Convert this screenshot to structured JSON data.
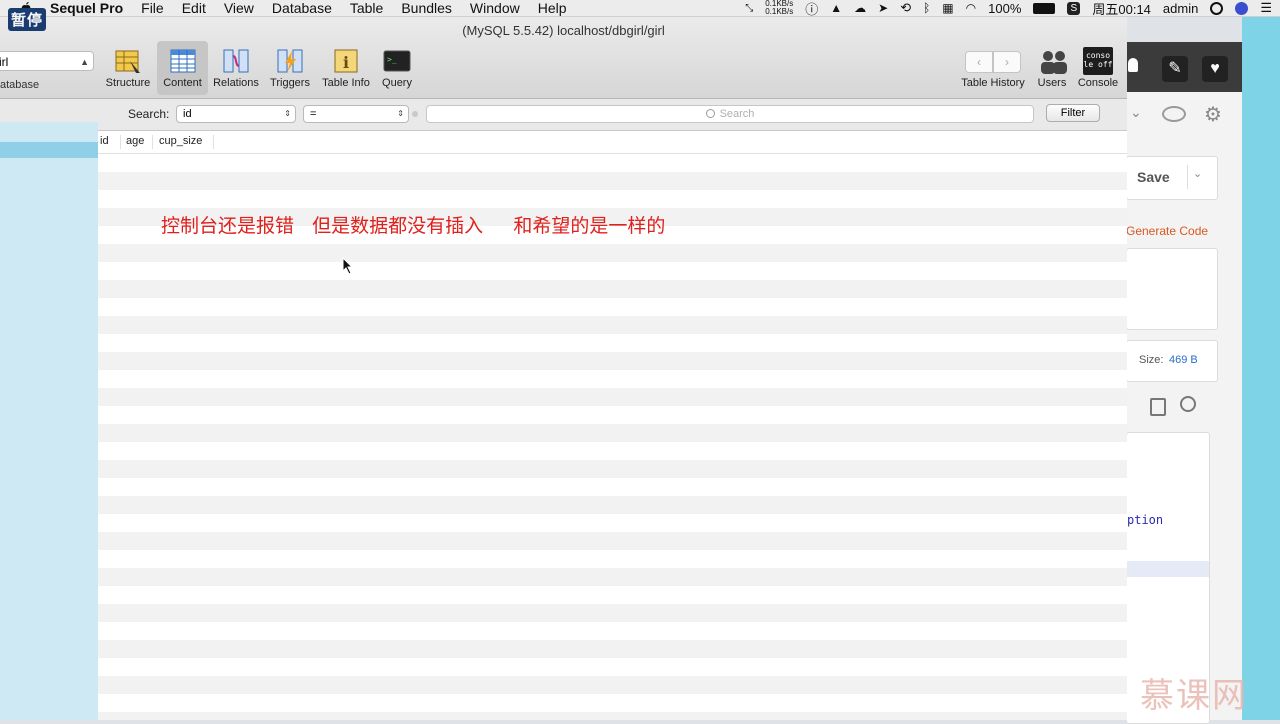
{
  "menubar": {
    "pause_label": "暂停",
    "app_name": "Sequel Pro",
    "items": [
      "File",
      "Edit",
      "View",
      "Database",
      "Table",
      "Bundles",
      "Window",
      "Help"
    ],
    "net_up": "0.1KB/s",
    "net_down": "0.1KB/s",
    "battery": "100%",
    "clock": "周五00:14",
    "user": "admin"
  },
  "window": {
    "title": "(MySQL 5.5.42) localhost/dbgirl/girl"
  },
  "toolbar": {
    "database_value": "irl",
    "database_label": "atabase",
    "buttons": [
      {
        "label": "Structure",
        "icon": "structure-icon"
      },
      {
        "label": "Content",
        "icon": "content-icon",
        "active": true
      },
      {
        "label": "Relations",
        "icon": "relations-icon"
      },
      {
        "label": "Triggers",
        "icon": "triggers-icon"
      },
      {
        "label": "Table Info",
        "icon": "table-info-icon"
      },
      {
        "label": "Query",
        "icon": "query-icon"
      }
    ],
    "table_history": "Table History",
    "users": "Users",
    "console": "Console",
    "console_icon_text": "conso le off"
  },
  "filter": {
    "search_label": "Search:",
    "field_value": "id",
    "operator_value": "=",
    "search_placeholder": "Search",
    "filter_button": "Filter"
  },
  "table": {
    "columns": [
      "id",
      "age",
      "cup_size"
    ]
  },
  "annotation": "控制台还是报错   但是数据都没有插入     和希望的是一样的",
  "background_window": {
    "save": "Save",
    "generate_code": "Generate Code",
    "size_label": "Size:",
    "size_value": "469 B",
    "code_fragment": "ption"
  },
  "watermark": "慕课网"
}
